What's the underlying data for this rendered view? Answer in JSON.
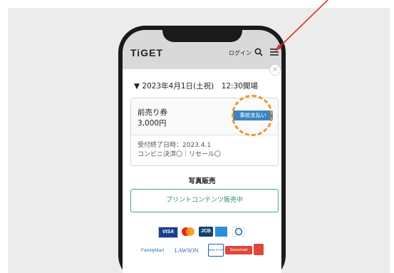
{
  "app": {
    "logo": "TiGET"
  },
  "header": {
    "login_label": "ログイン"
  },
  "modal": {
    "close_label": "×",
    "event_datetime": "▼ 2023年4月1日(土祝)　12:30開場",
    "ticket": {
      "name": "前売り券",
      "price": "3,000円",
      "payment_badge": "事前支払い",
      "deadline": "受付終了日時：2023.4.1",
      "options": "コンビニ決済〇｜リセール〇"
    },
    "photo_section_title": "写真販売",
    "print_button_label": "プリントコンテンツ販売中"
  },
  "payment_logos": {
    "visa": "VISA",
    "jcb": "JCB",
    "familymart": "FamilyMart",
    "lawson": "LAWSON",
    "ministop": "MINI STOP",
    "seicomart": "Seicomart"
  },
  "colors": {
    "annotation_arrow": "#e03030",
    "dashed_highlight": "#f0962e",
    "badge_blue": "#3a86c2",
    "print_button_green": "#3fa98a"
  }
}
